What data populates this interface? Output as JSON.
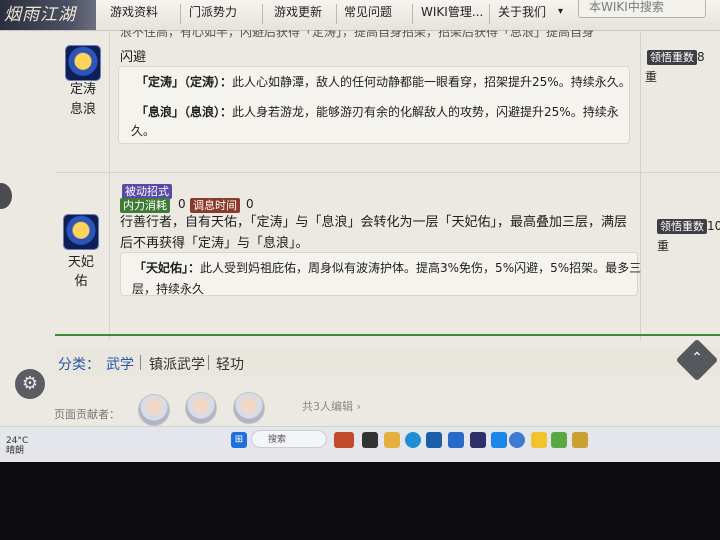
{
  "nav": {
    "logo": "烟雨江湖",
    "items": [
      "游戏资料",
      "门派势力",
      "游戏更新",
      "常见问题",
      "WIKI管理...",
      "关于我们"
    ],
    "dropdown_icon": "▾",
    "search_placeholder": "本WIKI中搜索"
  },
  "rows": [
    {
      "skill_name": "定涛息浪",
      "header_line1": "浪不住高，有心如半，闪避后获得「定涛」，提高自身招架，招架后获得「息浪」提高自身",
      "header_line2": "闪避",
      "effects": [
        {
          "label": "「定涛」（定涛）：",
          "text": "此人心如静潭，敌人的任何动静都能一眼看穿，招架提升25%。持续永久。"
        },
        {
          "label": "「息浪」（息浪）：",
          "text": "此人身若游龙，能够游刃有余的化解敌人的攻势，闪避提升25%。持续永",
          "text2": "久。"
        }
      ],
      "right_badge": "领悟重数",
      "right_value": "8",
      "right_unit": "重"
    },
    {
      "skill_name_line1": "天妃",
      "skill_name_line2": "佑",
      "tag": "被动招式",
      "mp_label": "内力消耗",
      "mp_value": "0",
      "cd_label": "调息时间",
      "cd_value": "0",
      "desc_line1": "行善行者，自有天佑，「定涛」与「息浪」会转化为一层「天妃佑」，最高叠加三层，满层",
      "desc_line2": "后不再获得「定涛」与「息浪」。",
      "effect_label": "「天妃佑」：",
      "effect_text1": "此人受到妈祖庇佑，周身似有波涛护体。提高3%免伤，5%闪避，5%招架。最多三",
      "effect_text2": "层，持续永久",
      "right_badge": "领悟重数",
      "right_value": "10",
      "right_unit": "重"
    }
  ],
  "categories": {
    "label": "分类：",
    "items": [
      "武学",
      "镇派武学",
      "轻功"
    ]
  },
  "contributors": {
    "label": "页面贡献者：",
    "summary": "共3人编辑",
    "chevron": "›"
  },
  "taskbar": {
    "weather_temp": "24°C",
    "weather_desc": "晴朗",
    "search_placeholder": "搜索"
  },
  "colors": {
    "accent_green": "#3b8a3e",
    "link_blue": "#2757a8",
    "badge_purple": "#5a4aa8"
  }
}
